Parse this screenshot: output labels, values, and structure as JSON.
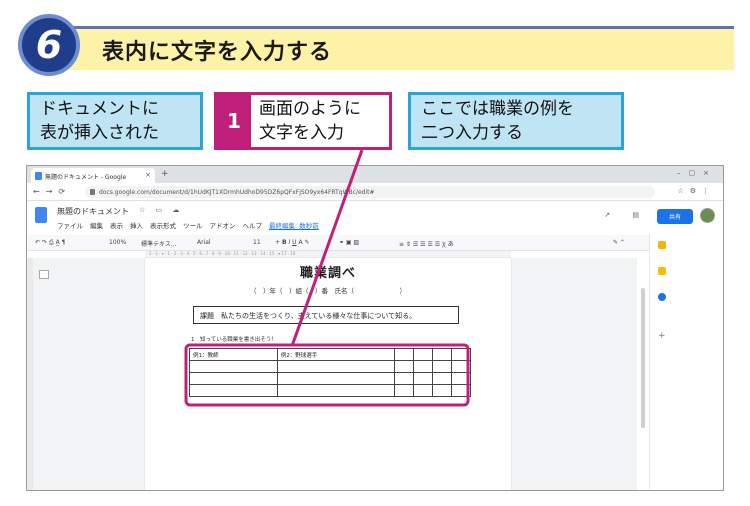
{
  "header": {
    "step_number": "6",
    "title": "表内に文字を入力する"
  },
  "callouts": {
    "left": {
      "line1": "ドキュメントに",
      "line2": "表が挿入された"
    },
    "step": {
      "number": "1",
      "line1": "画面のように",
      "line2": "文字を入力"
    },
    "right": {
      "line1": "ここでは職業の例を",
      "line2": "二つ入力する"
    }
  },
  "browser": {
    "tab_title": "無題のドキュメント - Google",
    "tab_close": "×",
    "new_tab": "+",
    "url": "docs.google.com/document/d/1hUdKJT1XDrmhUdhoD95DZ6pQFxFjSO9yx64FRTqWBc/edit#"
  },
  "docs": {
    "title": "無題のドキュメント",
    "menu": [
      "ファイル",
      "編集",
      "表示",
      "挿入",
      "表示形式",
      "ツール",
      "アドオン",
      "ヘルプ"
    ],
    "last_edit": "最終編集: 数秒前",
    "share_label": "共有",
    "toolbar": {
      "zoom": "100%",
      "style": "標準テキス...",
      "font": "Arial",
      "size": "11"
    }
  },
  "document": {
    "heading": "職業調べ",
    "student_line": "（　）年（　）組（　）番　氏名（　　　　　　　）",
    "theme": "課題　私たちの生活をつくり、支えている様々な仕事について知る。",
    "question": "1　知っている職業を書き出そう！",
    "table_rows": [
      [
        "例1：教師",
        "例2：野球選手",
        "",
        "",
        "",
        ""
      ],
      [
        "",
        "",
        "",
        "",
        "",
        ""
      ],
      [
        "",
        "",
        "",
        "",
        "",
        ""
      ],
      [
        "",
        "",
        "",
        "",
        "",
        ""
      ]
    ]
  },
  "colors": {
    "accent_blue": "#29a6d6",
    "step_magenta": "#c0207a",
    "header_yellow": "#fdf2a8",
    "circle_navy": "#1f3d8a"
  }
}
